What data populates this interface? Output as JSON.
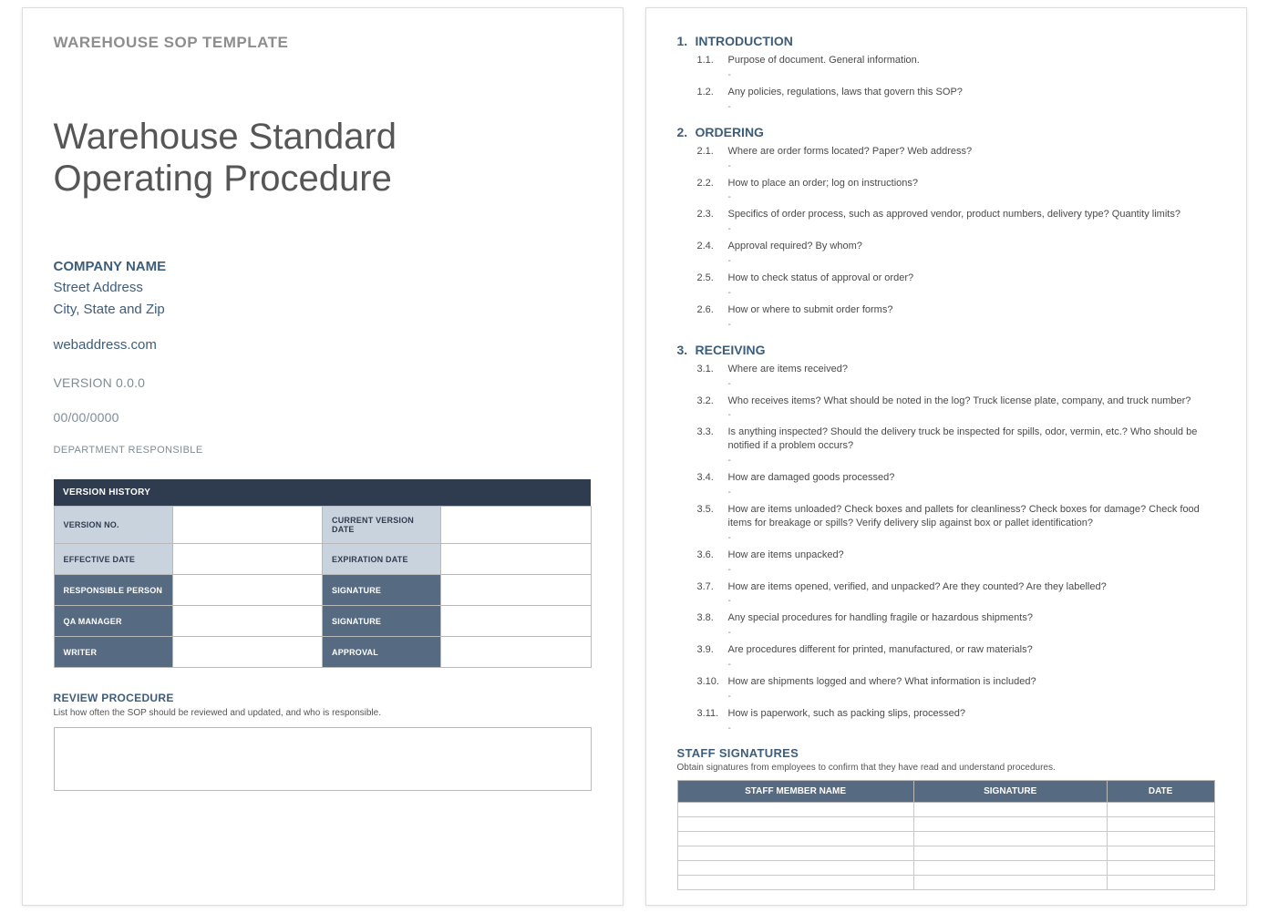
{
  "page1": {
    "header_label": "WAREHOUSE SOP TEMPLATE",
    "title_line1": "Warehouse Standard",
    "title_line2": "Operating Procedure",
    "company": {
      "name": "COMPANY NAME",
      "street": "Street Address",
      "city": "City, State and Zip",
      "web": "webaddress.com"
    },
    "version": "VERSION 0.0.0",
    "date": "00/00/0000",
    "department": "DEPARTMENT RESPONSIBLE",
    "version_table": {
      "header": "VERSION HISTORY",
      "rows": [
        {
          "l1": "VERSION NO.",
          "l2": "CURRENT VERSION DATE",
          "style": "light"
        },
        {
          "l1": "EFFECTIVE DATE",
          "l2": "EXPIRATION DATE",
          "style": "light"
        },
        {
          "l1": "RESPONSIBLE PERSON",
          "l2": "SIGNATURE",
          "style": "dark"
        },
        {
          "l1": "QA MANAGER",
          "l2": "SIGNATURE",
          "style": "dark"
        },
        {
          "l1": "WRITER",
          "l2": "APPROVAL",
          "style": "dark"
        }
      ]
    },
    "review": {
      "label": "REVIEW PROCEDURE",
      "desc": "List how often the SOP should be reviewed and updated, and who is responsible."
    }
  },
  "page2": {
    "sections": [
      {
        "num": "1.",
        "title": "INTRODUCTION",
        "items": [
          {
            "num": "1.1.",
            "text": "Purpose of document. General information."
          },
          {
            "num": "1.2.",
            "text": "Any policies, regulations, laws that govern this SOP?"
          }
        ]
      },
      {
        "num": "2.",
        "title": "ORDERING",
        "items": [
          {
            "num": "2.1.",
            "text": "Where are order forms located? Paper? Web address?"
          },
          {
            "num": "2.2.",
            "text": "How to place an order; log on instructions?"
          },
          {
            "num": "2.3.",
            "text": "Specifics of order process, such as approved vendor, product numbers, delivery type? Quantity limits?"
          },
          {
            "num": "2.4.",
            "text": "Approval required? By whom?"
          },
          {
            "num": "2.5.",
            "text": "How to check status of approval or order?"
          },
          {
            "num": "2.6.",
            "text": "How or where to submit order forms?"
          }
        ]
      },
      {
        "num": "3.",
        "title": "RECEIVING",
        "items": [
          {
            "num": "3.1.",
            "text": "Where are items received?"
          },
          {
            "num": "3.2.",
            "text": "Who receives items? What should be noted in the log? Truck license plate, company, and truck number?"
          },
          {
            "num": "3.3.",
            "text": "Is anything inspected? Should the delivery truck be inspected for spills, odor, vermin, etc.? Who should be notified if a problem occurs?"
          },
          {
            "num": "3.4.",
            "text": "How are damaged goods processed?"
          },
          {
            "num": "3.5.",
            "text": "How are items unloaded? Check boxes and pallets for cleanliness? Check boxes for damage? Check food items for breakage or spills? Verify delivery slip against box or pallet identification?"
          },
          {
            "num": "3.6.",
            "text": "How are items unpacked?"
          },
          {
            "num": "3.7.",
            "text": "How are items opened, verified, and unpacked? Are they counted? Are they labelled?"
          },
          {
            "num": "3.8.",
            "text": "Any special procedures for handling fragile or hazardous shipments?"
          },
          {
            "num": "3.9.",
            "text": "Are procedures different for printed, manufactured, or raw materials?"
          },
          {
            "num": "3.10.",
            "text": "How are shipments logged and where? What information is included?"
          },
          {
            "num": "3.11.",
            "text": "How is paperwork, such as packing slips, processed?"
          }
        ]
      }
    ],
    "staff": {
      "label": "STAFF SIGNATURES",
      "desc": "Obtain signatures from employees to confirm that they have read and understand procedures.",
      "cols": {
        "name": "STAFF MEMBER NAME",
        "sig": "SIGNATURE",
        "date": "DATE"
      },
      "blank_rows": 6
    }
  }
}
